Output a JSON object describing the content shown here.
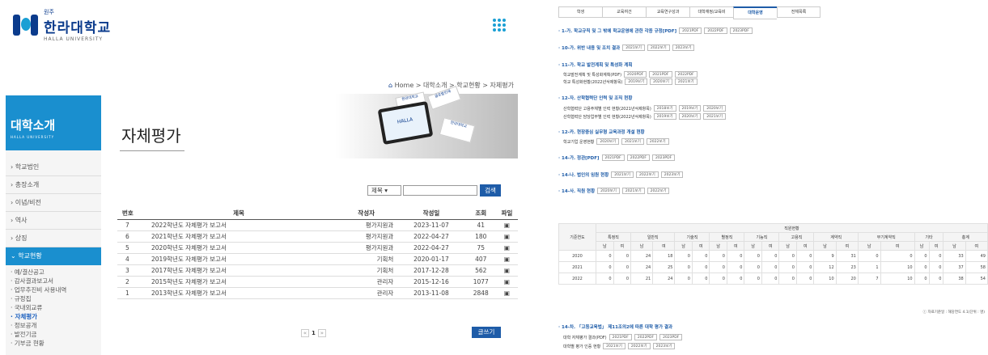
{
  "brand": {
    "small": "원주",
    "name": "한라대학교",
    "en": "HALLA UNIVERSITY"
  },
  "breadcrumb": [
    "Home",
    "대학소개",
    "학교현황",
    "자체평가"
  ],
  "sidebar": {
    "title": "대학소개",
    "subtitle": "HALLA UNIVERSITY",
    "items": [
      "학교법인",
      "총장소개",
      "이념/비전",
      "역사",
      "상징"
    ],
    "active": "학교현황",
    "sub": [
      "예/결산공고",
      "감사결과보고서",
      "업무추진비 사용내역",
      "규정집",
      "국내외교류",
      "자체평가",
      "정보공개",
      "발전기금",
      "기부금 현황"
    ],
    "sub_active": "자체평가"
  },
  "hero_cards": [
    "한라대학교",
    "HALLA",
    "한라대학교",
    "글로벌인재"
  ],
  "page_title": "자체평가",
  "search": {
    "select": "제목",
    "button": "검색"
  },
  "board": {
    "headers": [
      "번호",
      "제목",
      "작성자",
      "작성일",
      "조회",
      "파일"
    ],
    "rows": [
      [
        "7",
        "2022학년도 자체평가 보고서",
        "평가지원과",
        "2023-11-07",
        "41"
      ],
      [
        "6",
        "2021학년도 자체평가 보고서",
        "평가지원과",
        "2022-04-27",
        "180"
      ],
      [
        "5",
        "2020학년도 자체평가 보고서",
        "평가지원과",
        "2022-04-27",
        "75"
      ],
      [
        "4",
        "2019학년도 자체평가 보고서",
        "기획처",
        "2020-01-17",
        "407"
      ],
      [
        "3",
        "2017학년도 자체평가 보고서",
        "기획처",
        "2017-12-28",
        "562"
      ],
      [
        "2",
        "2015학년도 자체평가 보고서",
        "관리자",
        "2015-12-16",
        "1077"
      ],
      [
        "1",
        "2013학년도 자체평가 보고서",
        "관리자",
        "2013-11-08",
        "2848"
      ]
    ]
  },
  "pager": {
    "prev": "«",
    "current": "1",
    "next": "»"
  },
  "write_button": "글쓰기",
  "disclosure": {
    "tabs": [
      "학생",
      "교육여건",
      "교육연구성과",
      "대학재정/교육비",
      "대학운영",
      "전체목록"
    ],
    "active_tab": "대학운영",
    "sections": [
      {
        "title": "· 1-가. 학교규칙 및 그 밖에 학교운영에 관한 각종 규정[PDF]",
        "chips": [
          "2021PDF",
          "2022PDF",
          "2023PDF"
        ],
        "inline": true
      },
      {
        "title": "· 10-가. 위반 내용 및 조치 결과",
        "chips": [
          "2021보기",
          "2022보기",
          "2023보기"
        ],
        "inline": true
      },
      {
        "title": "· 11-가. 학교 발전계획 및 특성화 계획"
      },
      {
        "label": "학교발전계획 및 특성화계획(PDF)",
        "chips": [
          "2020PDF",
          "2021PDF",
          "2022PDF"
        ]
      },
      {
        "label": "학교 특성화현황(2022년삭제항목)",
        "chips": [
          "2019보기",
          "2020보기",
          "2021보기"
        ]
      },
      {
        "title": "· 12-자. 산학협력단 인력 및 조직 현황"
      },
      {
        "label": "산학협력단 고용주체별 인력 현황(2021년삭제항목)",
        "chips": [
          "2018보기",
          "2019보기",
          "2020보기"
        ]
      },
      {
        "label": "산학협력단 담당업무별 인력 현황(2022년삭제항목)",
        "chips": [
          "2019보기",
          "2020보기",
          "2021보기"
        ]
      },
      {
        "title": "· 12-카. 현장중심 실무형 교육과정 개설 현황"
      },
      {
        "label": "학교기업 운영현황",
        "chips": [
          "2020보기",
          "2021보기",
          "2022보기"
        ]
      },
      {
        "title": "· 14-가. 정관[PDF]",
        "chips": [
          "2021PDF",
          "2022PDF",
          "2023PDF"
        ],
        "inline": true
      },
      {
        "title": "· 14-나. 법인의 임원 현황",
        "chips": [
          "2021보기",
          "2022보기",
          "2023보기"
        ],
        "inline": true
      },
      {
        "title": "· 14-사. 직원 현황",
        "chips": [
          "2020보기",
          "2021보기",
          "2022보기"
        ],
        "inline": true
      }
    ],
    "staff_table": {
      "group_header": "직원현황",
      "year_header": "기준연도",
      "categories": [
        "특정직",
        "일반직",
        "기술직",
        "별정직",
        "기능직",
        "고용직",
        "계약직",
        "무기계약직",
        "기타",
        "총계"
      ],
      "mf": [
        "남",
        "여"
      ],
      "rows": [
        {
          "year": "2020",
          "vals": [
            "0",
            "0",
            "24",
            "18",
            "0",
            "0",
            "0",
            "0",
            "0",
            "0",
            "0",
            "0",
            "9",
            "31",
            "0",
            "0",
            "0",
            "0",
            "33",
            "49"
          ]
        },
        {
          "year": "2021",
          "vals": [
            "0",
            "0",
            "24",
            "25",
            "0",
            "0",
            "0",
            "0",
            "0",
            "0",
            "0",
            "0",
            "12",
            "23",
            "1",
            "10",
            "0",
            "0",
            "37",
            "58"
          ]
        },
        {
          "year": "2022",
          "vals": [
            "0",
            "0",
            "21",
            "24",
            "0",
            "0",
            "0",
            "0",
            "0",
            "0",
            "0",
            "0",
            "10",
            "20",
            "7",
            "10",
            "0",
            "0",
            "38",
            "54"
          ]
        }
      ],
      "note": "ⓘ 자료기준일 : 해당연도 4.1(단위 : 명)"
    },
    "bottom": {
      "title": "· 14-차. 「고등교육법」 제11조의2에 따른 대학 평가 결과",
      "rows": [
        {
          "label": "대학 자체평가 결과(PDF)",
          "chips": [
            "2021PDF",
            "2022PDF",
            "2023PDF"
          ]
        },
        {
          "label": "대학별 평가 인증 현황",
          "chips": [
            "2021보기",
            "2022보기",
            "2023보기"
          ]
        }
      ]
    }
  },
  "colors": {
    "primary": "#1a8fcf",
    "navy": "#0b3b8c",
    "button": "#1e5ca8"
  }
}
